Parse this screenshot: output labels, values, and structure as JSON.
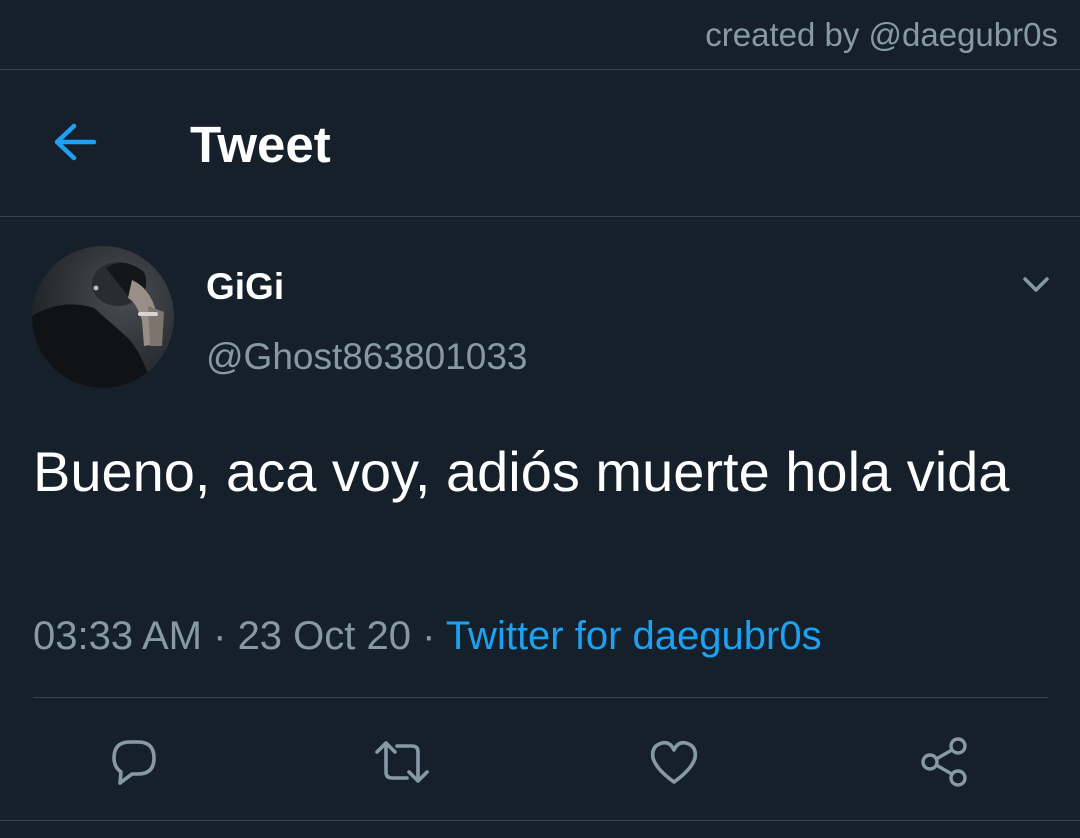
{
  "watermark": {
    "text": "created by @daegubr0s"
  },
  "header": {
    "title": "Tweet",
    "back_icon": "arrow-left-icon"
  },
  "tweet": {
    "author": {
      "display_name": "GiGi",
      "handle": "@Ghost863801033",
      "avatar": "avatar-photo"
    },
    "text": "Bueno, aca voy, adiós muerte hola vida",
    "time": "03:33 AM",
    "separator": " · ",
    "date": "23 Oct 20",
    "source": "Twitter for daegubr0s",
    "menu_icon": "chevron-down-icon"
  },
  "actions": [
    {
      "name": "reply",
      "icon": "reply-bubble-icon"
    },
    {
      "name": "retweet",
      "icon": "retweet-icon"
    },
    {
      "name": "like",
      "icon": "heart-icon"
    },
    {
      "name": "share",
      "icon": "share-icon"
    }
  ],
  "colors": {
    "background": "#15202b",
    "accent": "#1da1f2",
    "secondary_text": "#8899a6",
    "border": "#38444d"
  }
}
